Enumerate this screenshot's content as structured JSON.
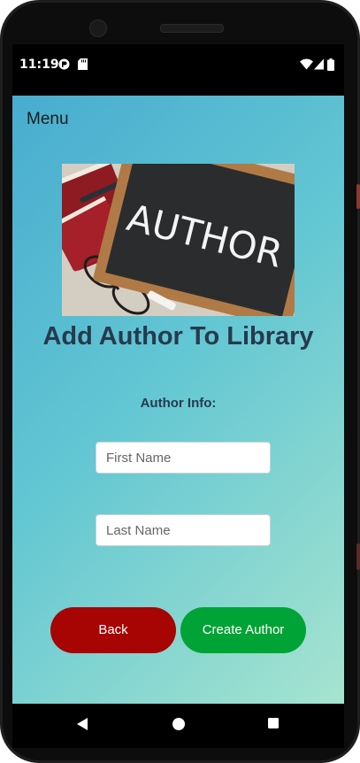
{
  "status_bar": {
    "time": "11:19",
    "icons": [
      "app-notification-icon",
      "sd-card-icon",
      "wifi-icon",
      "cell-signal-icon",
      "battery-icon"
    ]
  },
  "app": {
    "menu_label": "Menu",
    "hero_image": {
      "chalkboard_text": "AUTHOR"
    },
    "title": "Add Author To Library",
    "subtitle": "Author Info:",
    "first_name": {
      "placeholder": "First Name",
      "value": ""
    },
    "last_name": {
      "placeholder": "Last Name",
      "value": ""
    },
    "back_label": "Back",
    "create_label": "Create Author"
  },
  "colors": {
    "gradient_start": "#48acd0",
    "gradient_end": "#a6e4cf",
    "title_text": "#263a4e",
    "back_button": "#a70404",
    "create_button": "#00a335"
  },
  "nav_bar": {
    "icons": [
      "back-triangle-icon",
      "home-circle-icon",
      "recents-square-icon"
    ]
  }
}
